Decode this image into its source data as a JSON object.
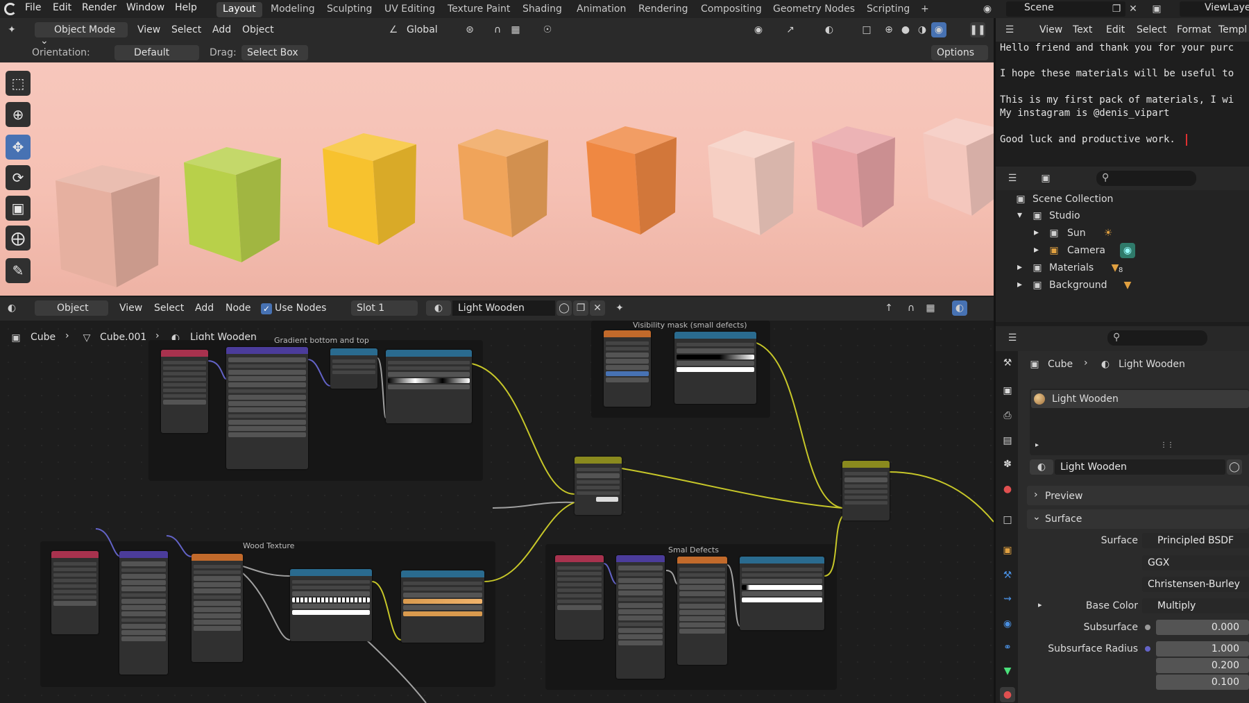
{
  "topbar": {
    "menus": [
      "File",
      "Edit",
      "Render",
      "Window",
      "Help"
    ],
    "workspaces": [
      "Layout",
      "Modeling",
      "Sculpting",
      "UV Editing",
      "Texture Paint",
      "Shading",
      "Animation",
      "Rendering",
      "Compositing",
      "Geometry Nodes",
      "Scripting"
    ],
    "active_workspace": "Layout",
    "add_tab": "+",
    "scene": "Scene",
    "view_layer": "ViewLayer"
  },
  "viewport": {
    "mode": "Object Mode",
    "menus": [
      "View",
      "Select",
      "Add",
      "Object"
    ],
    "transform": "Global",
    "orientation_label": "Orientation:",
    "orientation_value": "Default",
    "drag_label": "Drag:",
    "drag_value": "Select Box",
    "options": "Options",
    "cube_colors": [
      "#e6b0a0",
      "#b8d04a",
      "#f7c22e",
      "#f0a45a",
      "#ef8842",
      "#f6cfc3",
      "#e8a3a5",
      "#f4c7bd"
    ]
  },
  "node_editor": {
    "editor_type": "Object",
    "menus": [
      "View",
      "Select",
      "Add",
      "Node"
    ],
    "use_nodes_label": "Use Nodes",
    "use_nodes": true,
    "slot": "Slot 1",
    "material": "Light Wooden",
    "breadcrumb": [
      "Cube",
      "Cube.001",
      "Light Wooden"
    ],
    "frames": {
      "gradient": "Gradient bottom and top",
      "visibility": "Visibility mask (small defects)",
      "wood": "Wood Texture",
      "defects": "Smal Defects"
    }
  },
  "text_editor": {
    "menus": [
      "View",
      "Text",
      "Edit",
      "Select",
      "Format",
      "Templ"
    ],
    "lines": [
      "Hello friend and thank you for your purc",
      "I hope these materials will be useful to",
      "This is my first pack of materials, I wi",
      "My instagram is @denis_vipart",
      "Good luck and productive work."
    ]
  },
  "outliner": {
    "scene_collection": "Scene Collection",
    "studio": "Studio",
    "sun": "Sun",
    "camera": "Camera",
    "materials": "Materials",
    "materials_count": "8",
    "background": "Background"
  },
  "properties": {
    "breadcrumb": [
      "Cube",
      "Light Wooden"
    ],
    "slot_name": "Light Wooden",
    "material": "Light Wooden",
    "preview": "Preview",
    "surface_panel": "Surface",
    "rows": [
      {
        "label": "Surface",
        "value": "Principled BSDF",
        "dot": "#3fbf5f"
      },
      {
        "label": "",
        "value": "GGX",
        "dot": ""
      },
      {
        "label": "",
        "value": "Christensen-Burley",
        "dot": ""
      },
      {
        "label": "Base Color",
        "value": "Multiply",
        "dot": "#c7b21c"
      },
      {
        "label": "Subsurface",
        "value": "0.000",
        "dot": "#9a9a9a"
      },
      {
        "label": "Subsurface Radius",
        "value": "1.000",
        "dot": "#6363c7"
      },
      {
        "label": "",
        "value": "0.200",
        "dot": ""
      },
      {
        "label": "",
        "value": "0.100",
        "dot": ""
      }
    ]
  }
}
